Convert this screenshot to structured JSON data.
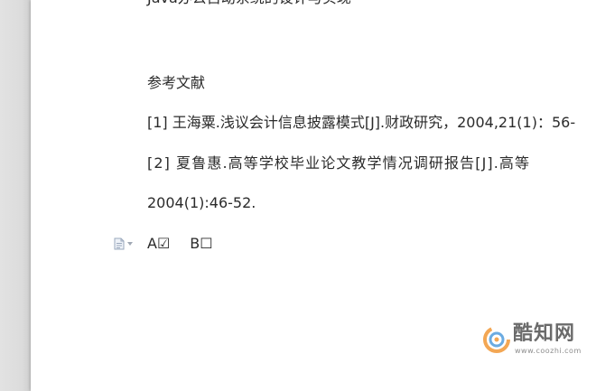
{
  "document": {
    "title_partial": "Java办公自动系统的设计与实现",
    "ref_heading": "参考文献",
    "references": [
      "[1]  王海粟.浅议会计信息披露模式[J].财政研究，2004,21(1)：56-",
      "[2]  夏鲁惠.高等学校毕业论文教学情况调研报告[J].高等",
      "2004(1):46-52."
    ],
    "checkboxes": {
      "a_label": "A☑",
      "b_label": "B☐"
    }
  },
  "watermark": {
    "brand": "酷知网",
    "url": "www.coozhi.com",
    "logo_icon": "coozhi-logo-icon"
  },
  "colors": {
    "page_bg": "#ffffff",
    "gutter_bg": "#e2e2e2",
    "text": "#2b2b2b",
    "logo_orange": "#f08a1c",
    "logo_blue": "#3a8fd8"
  }
}
